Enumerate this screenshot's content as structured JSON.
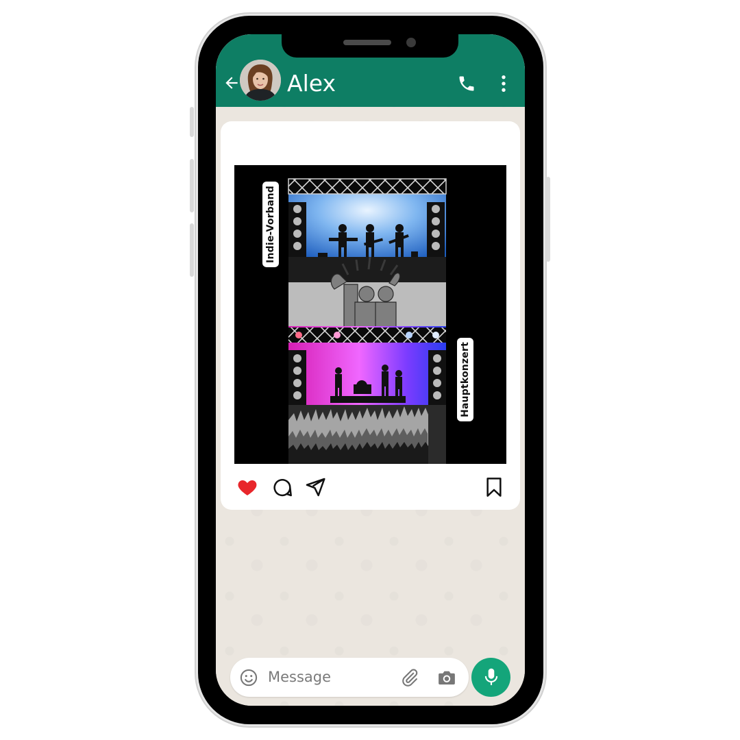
{
  "chat": {
    "contact_name": "Alex"
  },
  "post": {
    "label_top": "Indie-Vorband",
    "label_bottom": "Hauptkonzert",
    "liked": true
  },
  "composer": {
    "placeholder": "Message"
  },
  "icons": {
    "back": "arrow-left-icon",
    "call": "phone-icon",
    "menu": "more-vertical-icon",
    "like": "heart-icon",
    "comment": "comment-icon",
    "share": "send-icon",
    "save": "bookmark-icon",
    "emoji": "smiley-icon",
    "attach": "paperclip-icon",
    "camera": "camera-icon",
    "mic": "microphone-icon"
  },
  "colors": {
    "header": "#0e7e64",
    "mic_button": "#14a57a",
    "heart": "#e8262b"
  }
}
